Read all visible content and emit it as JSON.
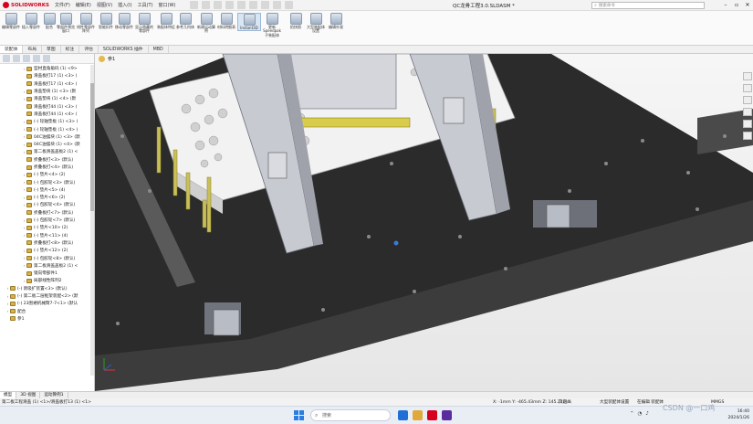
{
  "app": {
    "logo_text": "SOLIDWORKS",
    "document_title": "QC龙骨工程3.0.SLDASM *",
    "search_placeholder": "搜索命令",
    "menu": [
      "文件(F)",
      "编辑(E)",
      "视图(V)",
      "插入(I)",
      "工具(T)",
      "窗口(W)"
    ]
  },
  "commands": [
    {
      "label": "编辑零部件"
    },
    {
      "label": "插入零部件"
    },
    {
      "label": "配合"
    },
    {
      "label": "零部件预览窗口"
    },
    {
      "label": "线性零部件阵列"
    },
    {
      "label": "智能扣件"
    },
    {
      "label": "移动零部件"
    },
    {
      "label": "显示隐藏的零部件"
    },
    {
      "label": "装配体特征"
    },
    {
      "label": "参考几何体"
    },
    {
      "label": "新建运动算例"
    },
    {
      "label": "材料明细表"
    },
    {
      "label": "Instant3D"
    },
    {
      "label": "更新Speedpak子装配体"
    },
    {
      "label": "拍快照"
    },
    {
      "label": "大型装配体设置"
    },
    {
      "label": "编辑外观"
    }
  ],
  "command_tabs": [
    "装配体",
    "布局",
    "草图",
    "标注",
    "评估",
    "SOLIDWORKS 插件",
    "MBD"
  ],
  "command_tab_selected": 0,
  "tree": [
    {
      "text": "型材直角角码 (1) <9>",
      "exp": "›"
    },
    {
      "text": "滑盖板打17 (1) <3> (",
      "exp": ""
    },
    {
      "text": "滑盖板打17 (1) <4> (",
      "exp": ""
    },
    {
      "text": "滑盖垫块 (1) <3> (默",
      "exp": "›"
    },
    {
      "text": "滑盖垫块 (1) <4> (默",
      "exp": "›"
    },
    {
      "text": "滑盖板打44 (1) <3> (",
      "exp": ""
    },
    {
      "text": "滑盖板打44 (1) <4> (",
      "exp": ""
    },
    {
      "text": "(-) 轮轴垫板 (1) <3> (",
      "exp": "›"
    },
    {
      "text": "(-) 轮轴垫板 (1) <4> (",
      "exp": "›"
    },
    {
      "text": "04C油摆块 (1) <3> (默",
      "exp": "›"
    },
    {
      "text": "04C油摆块 (1) <4> (默",
      "exp": "›"
    },
    {
      "text": "第二板滑盖盖板2 (1) <",
      "exp": "›"
    },
    {
      "text": "折叠板打<3> (默认)",
      "exp": ""
    },
    {
      "text": "折叠板打<4> (默认)",
      "exp": ""
    },
    {
      "text": "(-) 垫片<4> (2)",
      "exp": "›"
    },
    {
      "text": "(-) 包胶轮<3> (默认)",
      "exp": "›"
    },
    {
      "text": "(-) 垫片<5> (4)",
      "exp": "›"
    },
    {
      "text": "(-) 垫片<6> (2)",
      "exp": "›"
    },
    {
      "text": "(-) 包胶轮<4> (默认)",
      "exp": "›"
    },
    {
      "text": "折叠板打<7> (默认)",
      "exp": ""
    },
    {
      "text": "(-) 包胶轮<7> (默认)",
      "exp": "›"
    },
    {
      "text": "(-) 垫片<10> (2)",
      "exp": "›"
    },
    {
      "text": "(-) 垫片<11> (4)",
      "exp": "›"
    },
    {
      "text": "折叠板打<8> (默认)",
      "exp": ""
    },
    {
      "text": "(-) 垫片<12> (2)",
      "exp": "›"
    },
    {
      "text": "(-) 包胶轮<8> (默认)",
      "exp": "›"
    },
    {
      "text": "第二板滑盖盖板2 (1) <",
      "exp": "›"
    },
    {
      "text": "镜向零部件1",
      "exp": ""
    },
    {
      "text": "局部线性阵列2",
      "exp": "›"
    },
    {
      "text": "(-) 新吸扩装置<3> (默认)",
      "exp": "›"
    },
    {
      "text": "(-) 第二板二层框架装配<2> (默",
      "exp": "›"
    },
    {
      "text": "(-) 23围裙机械臂7-7<1> (默认",
      "exp": "›"
    },
    {
      "text": "配合",
      "exp": "›"
    },
    {
      "text": "参1",
      "exp": ""
    }
  ],
  "hud": {
    "label": "参1"
  },
  "bottom_tabs": [
    "模型",
    "3D 视图",
    "运动算例1"
  ],
  "bottom_tab_selected": 0,
  "status": {
    "left": "第二板工程滑盖 (1) <1>/滑盖板打13 (1) <1>",
    "coords": "X: -1mm Y: -465.43mm Z: 145.21mm",
    "constraint": "欠定义",
    "mode": "大型装配体设置",
    "editing": "在编辑 装配体",
    "units": "MMGS"
  },
  "taskbar": {
    "search_text": "搜索",
    "time": "16:40",
    "date": "2024/1/26"
  },
  "watermark": "CSDN @一口鸡"
}
